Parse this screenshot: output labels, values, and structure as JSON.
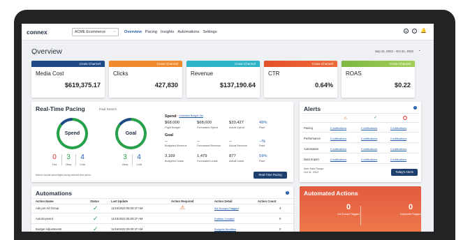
{
  "app": {
    "logo": "connex",
    "account": "ACME Ecommerce"
  },
  "nav": [
    "Overview",
    "Pacing",
    "Insights",
    "Automations",
    "Settings"
  ],
  "header": {
    "title": "Overview",
    "date_range": "Sep 21, 2022 - Oct 31, 2022"
  },
  "kpis": [
    {
      "tag": "Cross Channel",
      "label": "Media Cost",
      "value": "$619,375.17",
      "color": "#1e4a86"
    },
    {
      "tag": "Cross Channel",
      "label": "Clicks",
      "value": "427,830",
      "color": "#f08a2c"
    },
    {
      "tag": "Cross Channel",
      "label": "Revenue",
      "value": "$137,190.64",
      "color": "#2fb3c8"
    },
    {
      "tag": "Cross Channel",
      "label": "CTR",
      "value": "0.64%",
      "color": "#e4502a"
    },
    {
      "tag": "Cross Channel",
      "label": "ROAS",
      "value": "$0.22",
      "color": "#8bc34a"
    }
  ],
  "pacing": {
    "title": "Real-Time Pacing",
    "subtitle": "Paid Search",
    "rings": [
      {
        "label": "Spend",
        "fill": 0.86
      },
      {
        "label": "Goal",
        "fill": 0.86
      }
    ],
    "spend_counts": [
      {
        "value": "0",
        "label": "Hot"
      },
      {
        "value": "3",
        "label": "Okay"
      },
      {
        "value": "4",
        "label": "Cold"
      }
    ],
    "goal_counts": [
      {
        "value": "3",
        "label": "Okay"
      },
      {
        "value": "4",
        "label": "Cold"
      }
    ],
    "spend": {
      "heading": "Spend",
      "warn_note": "Unlimited Budget Set",
      "flight_budget": "$68,000",
      "flight_budget_label": "Flight Budget",
      "forecasted_spend": "$68,000",
      "forecasted_spend_label": "Forecasted Spend",
      "actual_spend": "$33,427",
      "actual_spend_label": "Actual Spend",
      "pace": "49%",
      "pace_label": "Pace"
    },
    "goal": {
      "heading": "Goal",
      "budgeted_revenue": "--",
      "budgeted_revenue_label": "Budgeted Revenue",
      "forecasted_revenue": "--",
      "forecasted_revenue_label": "Forecasted Revenue",
      "actual_revenue": "--",
      "actual_revenue_label": "Actual Revenue",
      "pace": "--%",
      "pace_label": "Pace",
      "budgeted_leads": "3,169",
      "budgeted_leads_label": "Budgeted Leads",
      "forecasted_leads": "1,479",
      "forecasted_leads_label": "Forecasted Leads",
      "actual_leads": "877",
      "actual_leads_label": "Actual Leads",
      "leads_pace": "59%",
      "leads_pace_label": "Pace"
    },
    "note": "Metrics include active flights during selected time period",
    "button": "Real-Time Pacing"
  },
  "alerts": {
    "title": "Alerts",
    "info": "i",
    "rows": [
      {
        "label": "Pacing",
        "cells": [
          "0 notifications",
          "0 notifications",
          "0 notifications"
        ]
      },
      {
        "label": "Performance",
        "cells": [
          "0 notifications",
          "0 notifications",
          "0 notifications"
        ]
      },
      {
        "label": "Automation",
        "cells": [
          "0 notifications",
          "0 notifications",
          "0 notifications"
        ]
      },
      {
        "label": "Data Import",
        "cells": [
          "0 notifications",
          "0 notifications",
          "0 notifications"
        ]
      }
    ],
    "alert_date_label": "Alert Date Range:",
    "alert_date": "Oct 31, 2022",
    "button": "Today's Alerts"
  },
  "automations": {
    "title": "Automations",
    "info": "i",
    "columns": [
      "Action Name",
      "Status",
      "Last Update",
      "Action Required",
      "Action Detail",
      "Action Count"
    ],
    "rows": [
      {
        "name": "Ads per Ad Group",
        "updated": "11/16/2022 05:00:37 AM",
        "detail": "Ad Groups Flagged",
        "count": "4",
        "warn": true
      },
      {
        "name": "AutoKeyword",
        "updated": "11/16/2022 05:00:37 AM",
        "detail": "Entities Created",
        "count": "0",
        "warn": false
      },
      {
        "name": "Budget Adjustments",
        "updated": "11/16/2022 05:00:37 AM",
        "detail": "Budgets Modified",
        "count": "0",
        "warn": false
      }
    ]
  },
  "automated_actions": {
    "title": "Automated Actions",
    "left_value": "0",
    "left_label": "Ad Groups Flagged",
    "right_value": "0",
    "right_label": "Keywords Flagged"
  },
  "colors": {
    "accent": "#1e5aa8",
    "ring": "#27a04a",
    "ring_track": "#1e4a86",
    "hot": "#d9302f",
    "okay": "#27a04a",
    "cold": "#1e5aa8"
  }
}
